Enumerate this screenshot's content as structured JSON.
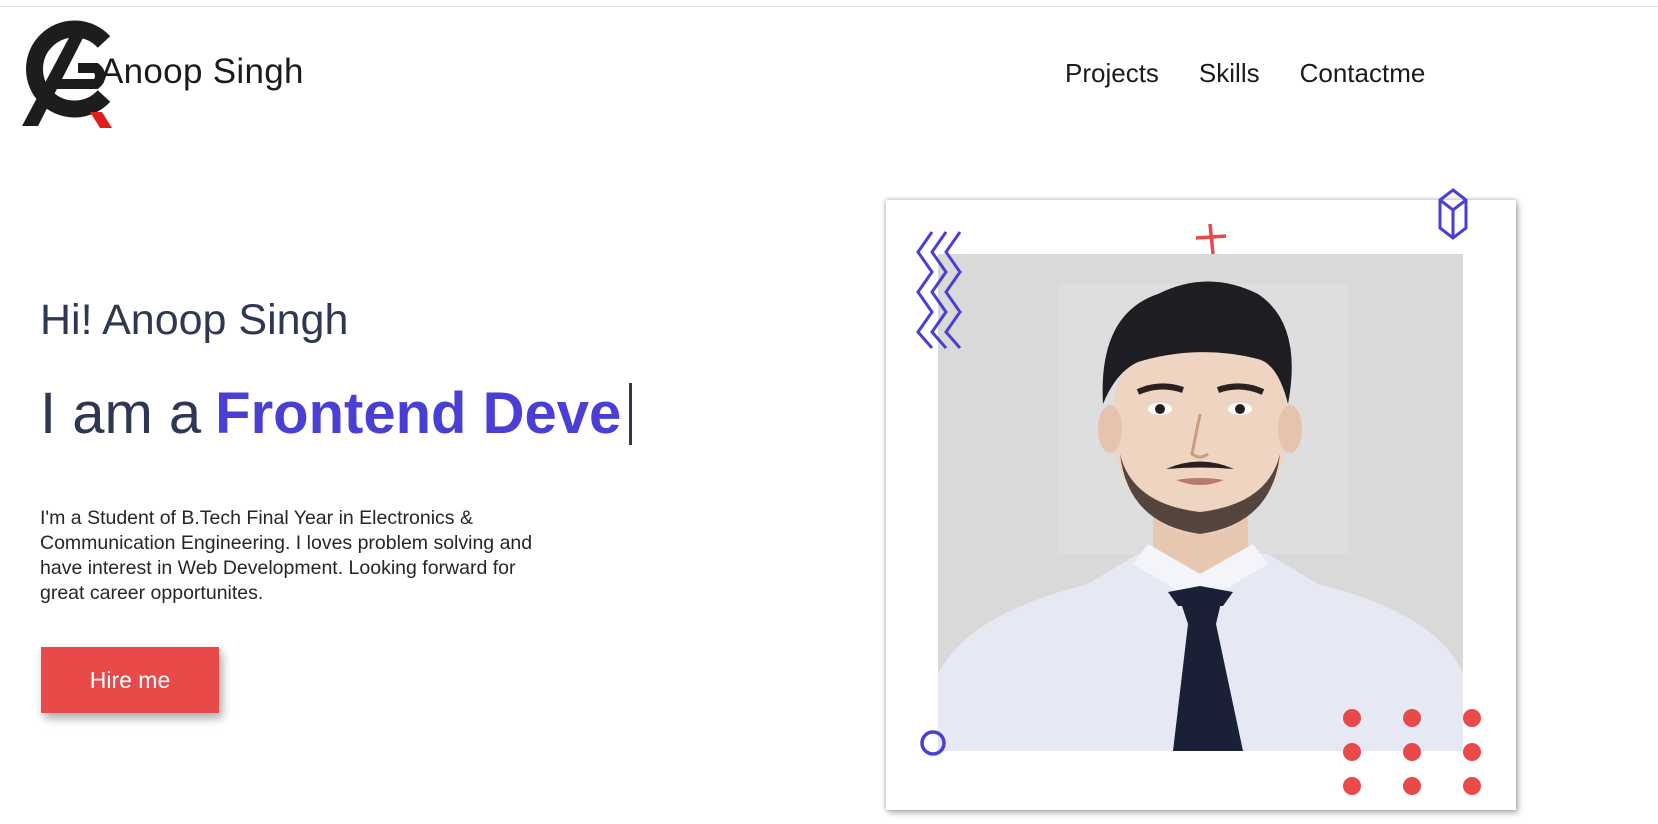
{
  "header": {
    "brand_name": "Anoop Singh",
    "logo_icon": "ap-monogram-logo-icon",
    "nav": [
      {
        "label": "Projects"
      },
      {
        "label": "Skills"
      },
      {
        "label": "Contactme"
      }
    ]
  },
  "hero": {
    "greeting": "Hi! Anoop Singh",
    "role_prefix": "I am a",
    "role_typed": "Frontend Deve",
    "bio": "I'm a Student of B.Tech Final Year in Electronics & Communication Engineering. I loves problem solving and have interest in Web Development. Looking forward for great career opportunites.",
    "hire_button": "Hire me"
  },
  "colors": {
    "accent_purple": "#4a3fd4",
    "accent_red": "#e84a4a",
    "text_dark": "#2f3852"
  }
}
